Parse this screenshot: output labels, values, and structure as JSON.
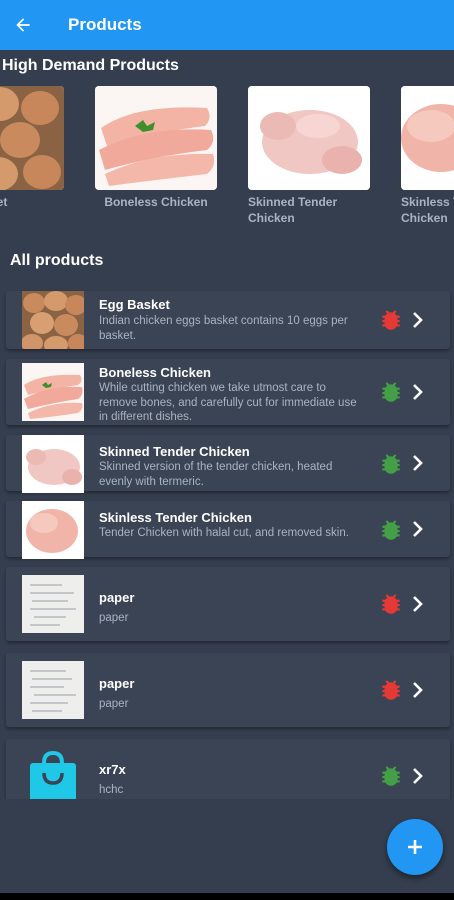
{
  "appbar": {
    "title": "Products"
  },
  "high_demand": {
    "title": "High Demand Products",
    "items": [
      {
        "label": "Egg Basket",
        "image": "eggs"
      },
      {
        "label": "Boneless Chicken",
        "image": "chicken-breast"
      },
      {
        "label": "Skinned Tender Chicken",
        "image": "whole-chicken"
      },
      {
        "label": "Skinless Tender Chicken",
        "image": "whole-chicken"
      }
    ]
  },
  "all_products": {
    "title": "All products",
    "items": [
      {
        "name": "Egg Basket",
        "description": "Indian chicken eggs basket contains 10 eggs per basket.",
        "status": "red",
        "image": "eggs"
      },
      {
        "name": "Boneless Chicken",
        "description": "While cutting chicken we take utmost care to remove bones, and carefully cut for immediate use in different dishes.",
        "status": "green",
        "image": "chicken-breast"
      },
      {
        "name": "Skinned Tender Chicken",
        "description": "Skinned version of the tender chicken, heated evenly with termeric.",
        "status": "green",
        "image": "whole-chicken"
      },
      {
        "name": "Skinless Tender Chicken",
        "description": "Tender Chicken with halal cut, and removed skin.",
        "status": "green",
        "image": "whole-chicken"
      },
      {
        "name": "paper",
        "description": "paper",
        "status": "red",
        "image": "paper"
      },
      {
        "name": "paper",
        "description": "paper",
        "status": "red",
        "image": "paper"
      },
      {
        "name": "xr7x",
        "description": "hchc",
        "status": "green",
        "image": "shopping-bag-icon"
      }
    ]
  },
  "colors": {
    "primary": "#2196f3",
    "background": "#353e4e",
    "card": "#3b4455",
    "status_red": "#e53935",
    "status_green": "#43a047",
    "bag": "#1ec8e6"
  },
  "icons": {
    "back": "arrow-back-icon",
    "chevron": "chevron-right-icon",
    "status": "bug-status-icon",
    "fab": "add-icon"
  }
}
